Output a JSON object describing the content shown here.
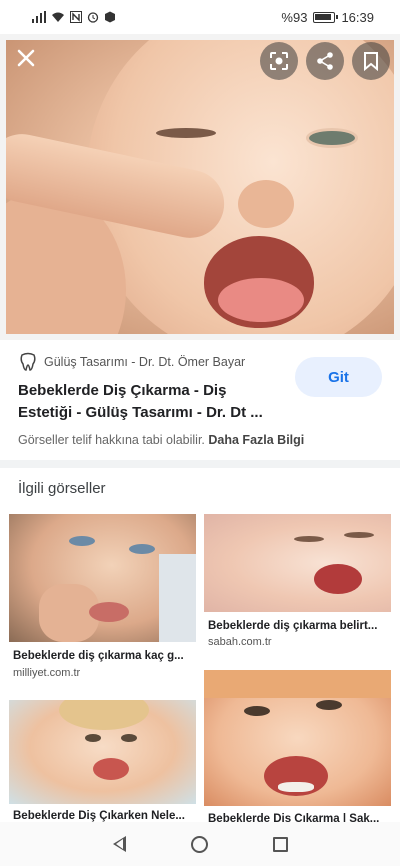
{
  "status_bar": {
    "battery_text": "%93",
    "battery_level": 0.93,
    "time": "16:39"
  },
  "viewer": {
    "close_icon": "close-icon",
    "lens_icon": "lens-icon",
    "share_icon": "share-icon",
    "bookmark_icon": "bookmark-icon"
  },
  "result": {
    "source_name": "Gülüş Tasarımı - Dr. Dt. Ömer Bayar",
    "title": "Bebeklerde Diş Çıkarma - Diş Estetiği - Gülüş Tasarımı - Dr. Dt ...",
    "visit_label": "Git",
    "copyright_text": "Görseller telif hakkına tabi olabilir.",
    "learn_more": "Daha Fazla Bilgi"
  },
  "related": {
    "heading": "İlgili görseller",
    "items": [
      {
        "caption": "Bebeklerde diş çıkarma kaç g...",
        "source": "milliyet.com.tr"
      },
      {
        "caption": "Bebeklerde diş çıkarma belirt...",
        "source": "sabah.com.tr"
      },
      {
        "caption": "Bebeklerde Diş Çıkarken Nele...",
        "source": ""
      },
      {
        "caption": "Bebeklerde Diş Çıkarma | Sak...",
        "source": ""
      }
    ]
  },
  "colors": {
    "accent": "#1a73e8",
    "button_bg": "#e8f0fe"
  }
}
